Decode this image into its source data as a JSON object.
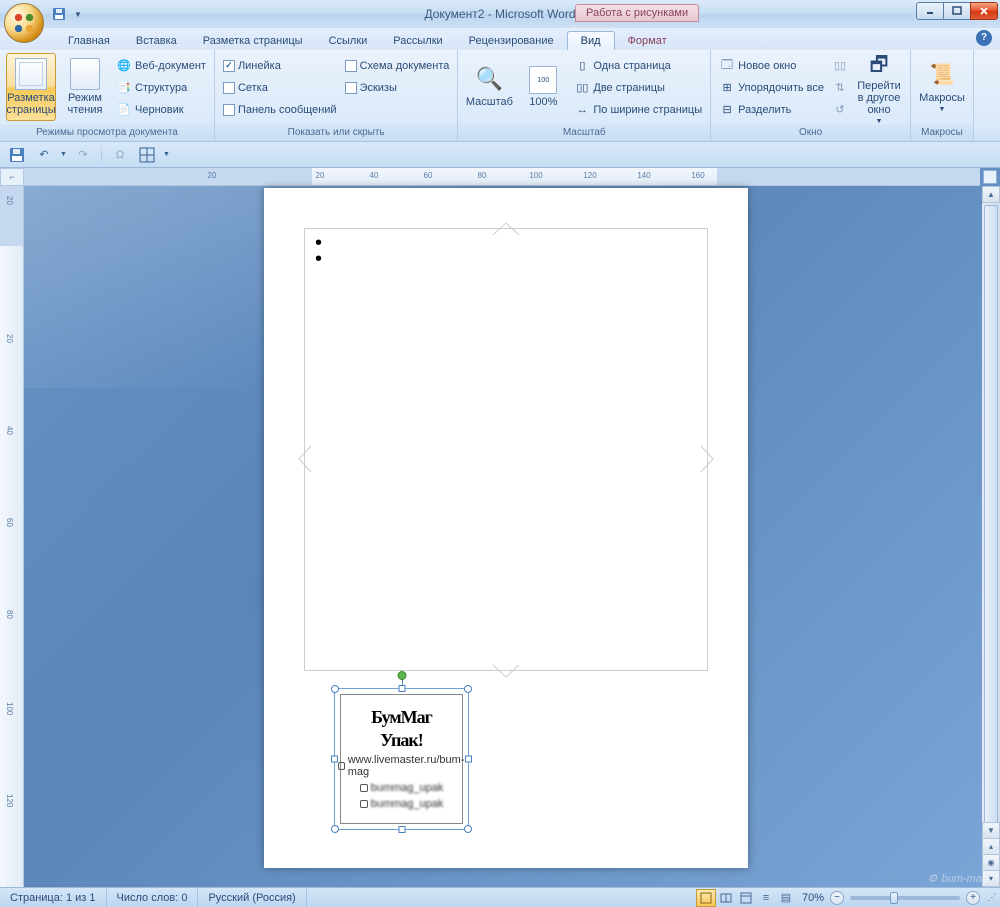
{
  "title": "Документ2 - Microsoft Word",
  "context_title": "Работа с рисунками",
  "tabs": {
    "home": "Главная",
    "insert": "Вставка",
    "layout": "Разметка страницы",
    "references": "Ссылки",
    "mailings": "Рассылки",
    "review": "Рецензирование",
    "view": "Вид",
    "format": "Формат"
  },
  "ribbon": {
    "views": {
      "print_layout": "Разметка страницы",
      "reading": "Режим чтения",
      "web": "Веб-документ",
      "outline": "Структура",
      "draft": "Черновик",
      "group": "Режимы просмотра документа"
    },
    "show": {
      "ruler": "Линейка",
      "grid": "Сетка",
      "msgbar": "Панель сообщений",
      "docmap": "Схема документа",
      "thumbs": "Эскизы",
      "group": "Показать или скрыть"
    },
    "zoom": {
      "zoom": "Масштаб",
      "hundred": "100%",
      "one": "Одна страница",
      "two": "Две страницы",
      "width": "По ширине страницы",
      "group": "Масштаб"
    },
    "window": {
      "new": "Новое окно",
      "arrange": "Упорядочить все",
      "split": "Разделить",
      "switch": "Перейти в другое окно",
      "group": "Окно"
    },
    "macros": {
      "macros": "Макросы",
      "group": "Макросы"
    }
  },
  "image": {
    "logo1": "БумМаг",
    "logo2": "Упак!",
    "url": "www.livemaster.ru/bum-mag",
    "social1": "bummag_upak",
    "social2": "bummag_upak"
  },
  "status": {
    "page": "Страница: 1 из 1",
    "words": "Число слов: 0",
    "lang": "Русский (Россия)",
    "zoom": "70%"
  },
  "watermark": "bum-mag",
  "ruler_vals": [
    "20",
    "",
    "",
    "",
    "20",
    "",
    "40",
    "",
    "60",
    "",
    "80",
    "",
    "100",
    "",
    "120",
    "",
    "140",
    "",
    "160"
  ]
}
